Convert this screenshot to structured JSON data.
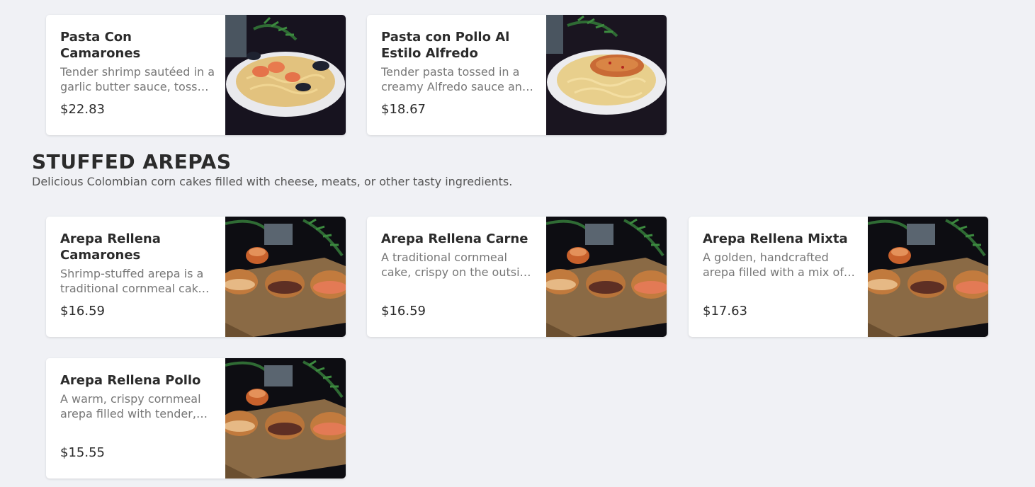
{
  "pasta_items": [
    {
      "title": "Pasta Con Camarones",
      "description": "Tender shrimp sautéed in a garlic butter sauce, tossed with pasta.",
      "price": "$22.83"
    },
    {
      "title": "Pasta con Pollo Al Estilo Alfredo",
      "description": "Tender pasta tossed in a creamy Alfredo sauce and topped with chicken.",
      "price": "$18.67"
    }
  ],
  "section": {
    "title": "STUFFED AREPAS",
    "description": "Delicious Colombian corn cakes filled with cheese, meats, or other tasty ingredients."
  },
  "arepa_items": [
    {
      "title": "Arepa Rellena Camarones",
      "description": "Shrimp-stuffed arepa is a traditional cornmeal cake, filled with shrimp.",
      "price": "$16.59"
    },
    {
      "title": "Arepa Rellena Carne",
      "description": "A traditional cornmeal cake, crispy on the outside and soft inside.",
      "price": "$16.59"
    },
    {
      "title": "Arepa Rellena Mixta",
      "description": "A golden, handcrafted arepa filled with a mix of meats.",
      "price": "$17.63"
    },
    {
      "title": "Arepa Rellena Pollo",
      "description": "A warm, crispy cornmeal arepa filled with tender, shredded chicken.",
      "price": "$15.55"
    }
  ]
}
